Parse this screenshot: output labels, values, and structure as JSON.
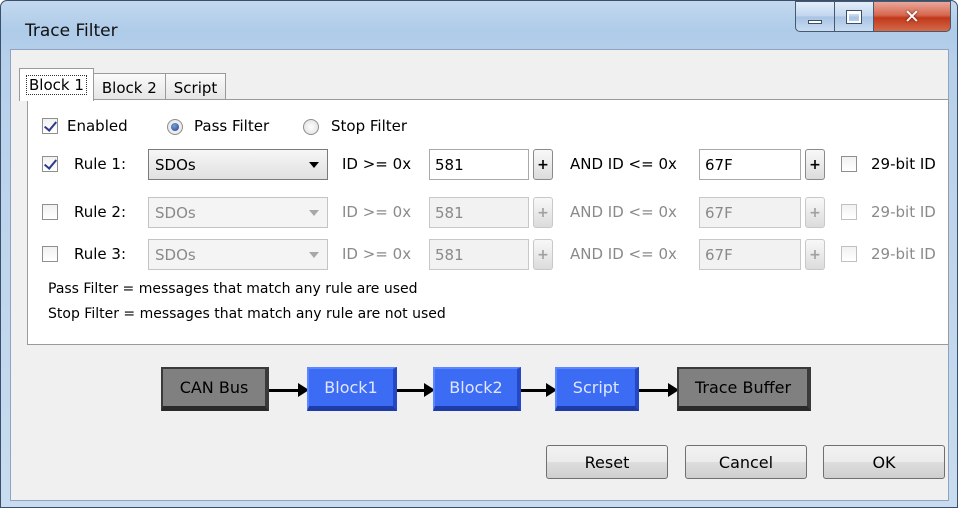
{
  "window": {
    "title": "Trace Filter",
    "controls": {
      "minimize": "minimize-icon",
      "maximize": "maximize-icon",
      "close": "close-icon"
    }
  },
  "tabs": [
    {
      "label": "Block 1",
      "active": true
    },
    {
      "label": "Block 2",
      "active": false
    },
    {
      "label": "Script",
      "active": false
    }
  ],
  "filter": {
    "enabled_label": "Enabled",
    "enabled": true,
    "mode": "pass",
    "pass_label": "Pass Filter",
    "stop_label": "Stop Filter"
  },
  "rules": [
    {
      "label": "Rule 1:",
      "checked": true,
      "enabled": true,
      "type": "SDOs",
      "ge_label": "ID >= 0x",
      "ge_value": "581",
      "plus": "+",
      "le_label": "AND ID <= 0x",
      "le_value": "67F",
      "bit29_label": "29-bit ID",
      "bit29": false
    },
    {
      "label": "Rule 2:",
      "checked": false,
      "enabled": false,
      "type": "SDOs",
      "ge_label": "ID >= 0x",
      "ge_value": "581",
      "plus": "+",
      "le_label": "AND ID <= 0x",
      "le_value": "67F",
      "bit29_label": "29-bit ID",
      "bit29": false
    },
    {
      "label": "Rule 3:",
      "checked": false,
      "enabled": false,
      "type": "SDOs",
      "ge_label": "ID >= 0x",
      "ge_value": "581",
      "plus": "+",
      "le_label": "AND ID <= 0x",
      "le_value": "67F",
      "bit29_label": "29-bit ID",
      "bit29": false
    }
  ],
  "notes": {
    "pass": "Pass Filter = messages that match any rule are used",
    "stop": "Stop Filter = messages that match any rule are not used"
  },
  "pipeline": [
    {
      "label": "CAN Bus",
      "style": "gray"
    },
    {
      "label": "Block1",
      "style": "blue"
    },
    {
      "label": "Block2",
      "style": "blue"
    },
    {
      "label": "Script",
      "style": "blue"
    },
    {
      "label": "Trace Buffer",
      "style": "gray"
    }
  ],
  "buttons": {
    "reset": "Reset",
    "cancel": "Cancel",
    "ok": "OK"
  },
  "colors": {
    "pipeline_blue": "#3d6cf4",
    "pipeline_gray": "#808080",
    "title_bar": "#aecbe8"
  }
}
